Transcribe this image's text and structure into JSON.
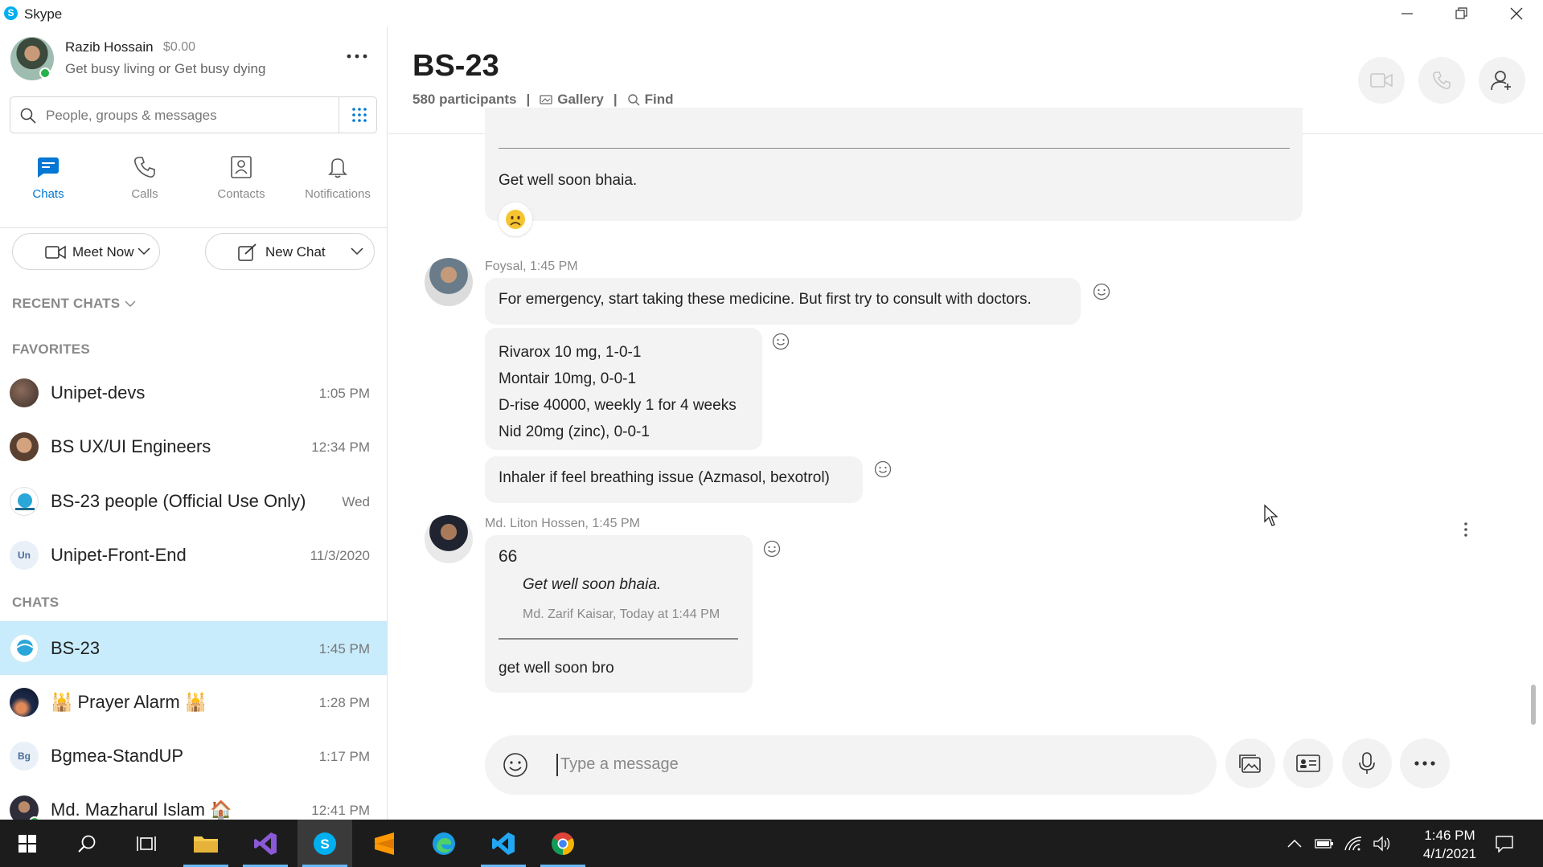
{
  "window": {
    "app_title": "Skype"
  },
  "profile": {
    "name": "Razib Hossain",
    "credit": "$0.00",
    "mood": "Get busy living or Get busy dying"
  },
  "search": {
    "placeholder": "People, groups & messages"
  },
  "nav": {
    "chats": "Chats",
    "calls": "Calls",
    "contacts": "Contacts",
    "notifications": "Notifications"
  },
  "actions": {
    "meet_now": "Meet Now",
    "new_chat": "New Chat"
  },
  "sections": {
    "recent": "RECENT CHATS",
    "favorites": "FAVORITES",
    "chats": "CHATS"
  },
  "favorites": [
    {
      "name": "Unipet-devs",
      "time": "1:05 PM"
    },
    {
      "name": "BS UX/UI Engineers",
      "time": "12:34 PM"
    },
    {
      "name": "BS-23 people (Official Use Only)",
      "time": "Wed"
    },
    {
      "name": "Unipet-Front-End",
      "time": "11/3/2020",
      "initials": "Un"
    }
  ],
  "chats": [
    {
      "name": "BS-23",
      "time": "1:45 PM"
    },
    {
      "name": "🕌 Prayer Alarm 🕌",
      "time": "1:28 PM"
    },
    {
      "name": "Bgmea-StandUP",
      "time": "1:17 PM",
      "initials": "Bg"
    },
    {
      "name": "Md. Mazharul Islam 🏠",
      "time": "12:41 PM"
    }
  ],
  "conversation": {
    "title": "BS-23",
    "participants": "580 participants",
    "gallery": "Gallery",
    "find": "Find",
    "messages": {
      "top_text": "Get well soon bhaia.",
      "foysal_meta": "Foysal, 1:45 PM",
      "foysal_1": "For emergency, start taking these medicine. But first try to consult with doctors.",
      "foysal_2_lines": [
        "Rivarox 10 mg, 1-0-1",
        "Montair 10mg, 0-0-1",
        "D-rise 40000, weekly 1 for 4 weeks",
        "Nid 20mg (zinc), 0-0-1"
      ],
      "foysal_3": "Inhaler if feel breathing issue (Azmasol, bexotrol)",
      "liton_meta": "Md. Liton Hossen, 1:45 PM",
      "liton_quote_mark": "66",
      "liton_quote": "Get well soon bhaia.",
      "liton_quote_source": "Md. Zarif Kaisar, Today at 1:44 PM",
      "liton_reply": "get well soon bro"
    },
    "composer_placeholder": "Type a message"
  },
  "taskbar": {
    "time": "1:46 PM",
    "date": "4/1/2021"
  },
  "colors": {
    "accent": "#0078d4",
    "selected_row": "#c8ecfb",
    "bubble": "#f3f3f3",
    "online": "#27b14a"
  }
}
